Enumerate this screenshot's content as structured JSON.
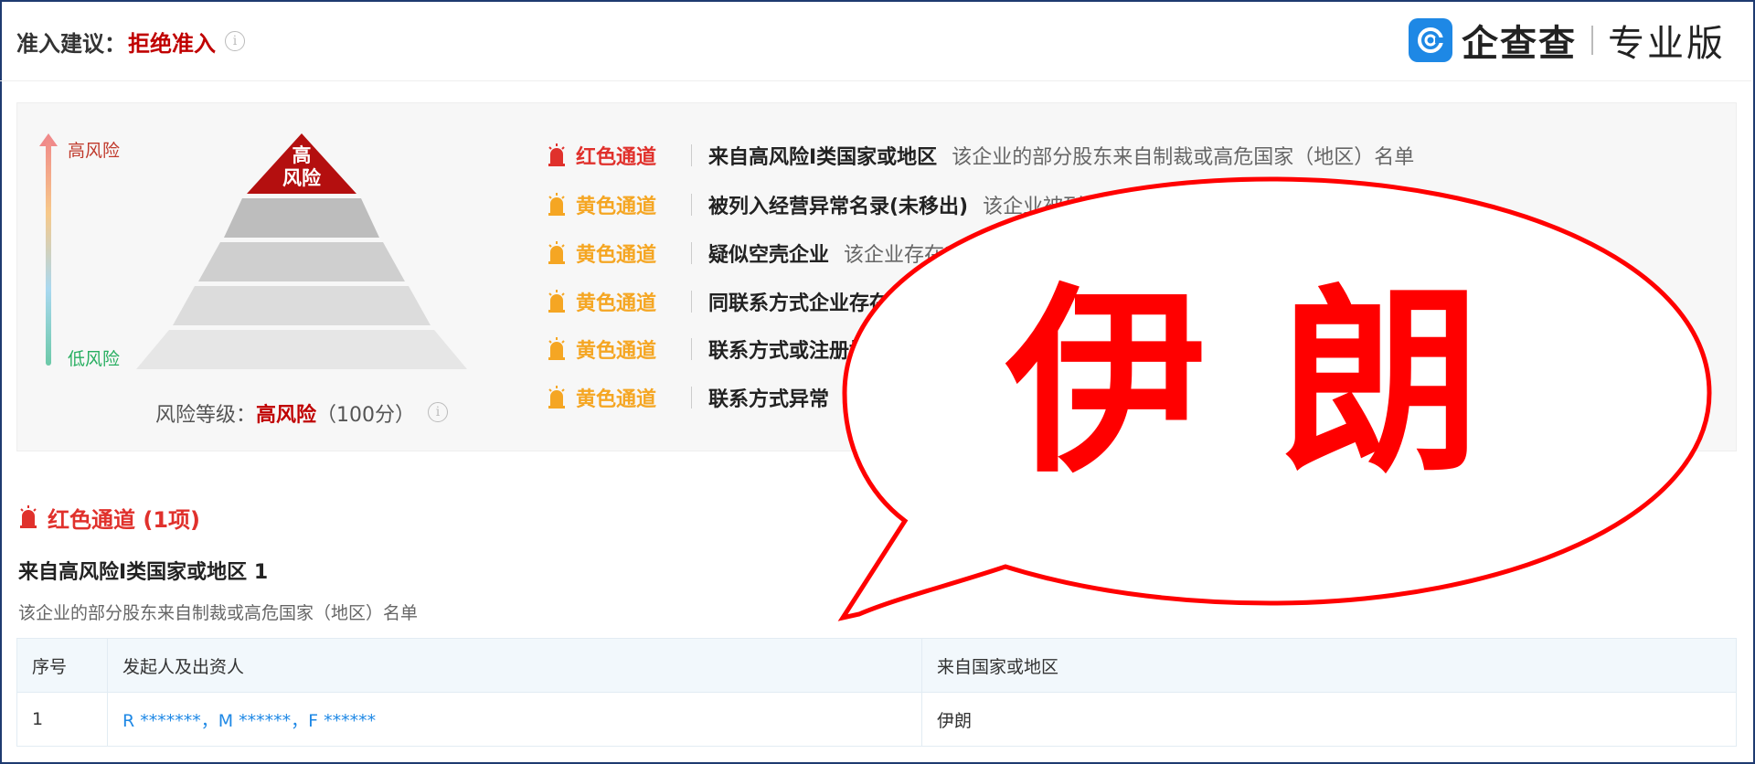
{
  "header": {
    "recommend_label": "准入建议：",
    "recommend_value": "拒绝准入",
    "logo_name": "企查查",
    "logo_edition": "专业版"
  },
  "risk_panel": {
    "high_label": "高风险",
    "low_label": "低风险",
    "pyramid_top": "高\n风险",
    "level_label": "风险等级：",
    "level_value": "高风险",
    "level_score": "（100分）"
  },
  "channels": [
    {
      "type": "red",
      "name": "红色通道",
      "title": "来自高风险I类国家或地区",
      "desc": "该企业的部分股东来自制裁或高危国家（地区）名单"
    },
    {
      "type": "yellow",
      "name": "黄色通道",
      "title": "被列入经营异常名录(未移出)",
      "desc": "该企业被列"
    },
    {
      "type": "yellow",
      "name": "黄色通道",
      "title": "疑似空壳企业",
      "desc": "该企业存在2"
    },
    {
      "type": "yellow",
      "name": "黄色通道",
      "title": "同联系方式企业存在",
      "desc": ""
    },
    {
      "type": "yellow",
      "name": "黄色通道",
      "title": "联系方式或注册地",
      "desc": ""
    },
    {
      "type": "yellow",
      "name": "黄色通道",
      "title": "联系方式异常",
      "desc": ""
    }
  ],
  "section": {
    "heading": "红色通道 (1项)",
    "subtitle": "来自高风险I类国家或地区 1",
    "desc": "该企业的部分股东来自制裁或高危国家（地区）名单"
  },
  "table": {
    "headers": [
      "序号",
      "发起人及出资人",
      "来自国家或地区"
    ],
    "rows": [
      {
        "index": "1",
        "investors": "R *******，M ******，F ******",
        "country": "伊朗"
      }
    ]
  },
  "overlay": {
    "text": "伊朗"
  },
  "colors": {
    "red_channel": "#e0312c",
    "yellow_channel": "#f5a623",
    "reject": "#c00000",
    "overlay_text": "#ff0000",
    "link": "#1e88e5"
  }
}
